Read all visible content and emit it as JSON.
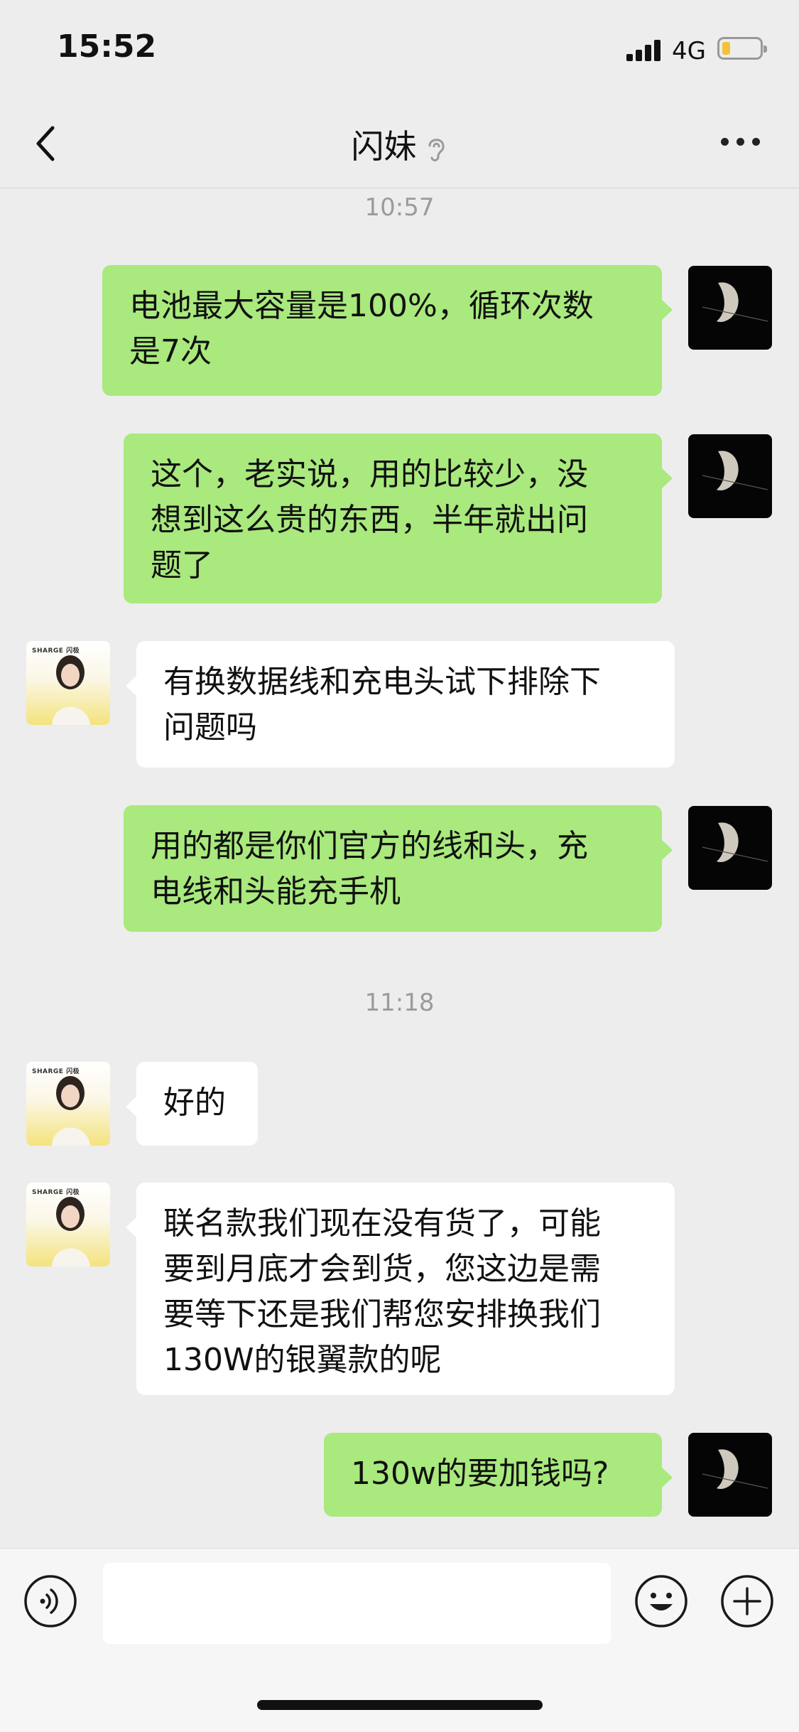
{
  "status": {
    "time": "15:52",
    "network": "4G",
    "battery_level": 0.22
  },
  "header": {
    "title": "闪妹",
    "ear_icon": "ear-icon",
    "back_icon": "chevron-left-icon",
    "more_icon": "ellipsis-icon"
  },
  "timestamps": [
    "10:57",
    "11:18"
  ],
  "messages": [
    {
      "from": "me",
      "lines": [
        "电池最大容量是100%，循环次数",
        "是7次"
      ]
    },
    {
      "from": "me",
      "lines": [
        "这个，老实说，用的比较少，没",
        "想到这么贵的东西，半年就出问",
        "题了"
      ]
    },
    {
      "from": "contact",
      "lines": [
        "有换数据线和充电头试下排除下",
        "问题吗"
      ]
    },
    {
      "from": "me",
      "lines": [
        "用的都是你们官方的线和头，充",
        "电线和头能充手机"
      ]
    },
    {
      "from": "contact",
      "lines": [
        "好的"
      ]
    },
    {
      "from": "contact",
      "lines": [
        "联名款我们现在没有货了，可能",
        "要到月底才会到货，您这边是需",
        "要等下还是我们帮您安排换我们",
        "130W的银翼款的呢"
      ]
    },
    {
      "from": "me",
      "lines": [
        "130w的要加钱吗?"
      ]
    }
  ],
  "contact_avatar": {
    "brand": "SHARGE 闪极"
  },
  "input": {
    "value": "",
    "voice_icon": "voice-icon",
    "emoji_icon": "emoji-icon",
    "plus_icon": "plus-icon"
  },
  "colors": {
    "sent_bubble": "#a9e97d",
    "received_bubble": "#ffffff",
    "background": "#ededed"
  }
}
